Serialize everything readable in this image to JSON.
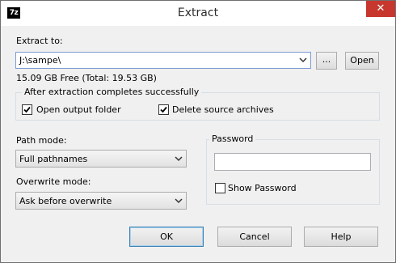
{
  "window": {
    "title": "Extract",
    "app_icon": "7z",
    "close_glyph": "✕"
  },
  "extract_to": {
    "label": "Extract to:",
    "path": "J:\\sampe\\",
    "browse_label": "...",
    "open_label": "Open",
    "free_space": "15.09 GB Free (Total: 19.53 GB)"
  },
  "after_extraction": {
    "title": "After extraction completes successfully",
    "open_output_label": "Open output folder",
    "open_output_checked": true,
    "delete_source_label": "Delete source archives",
    "delete_source_checked": true
  },
  "path_mode": {
    "label": "Path mode:",
    "value": "Full pathnames"
  },
  "overwrite_mode": {
    "label": "Overwrite mode:",
    "value": "Ask before overwrite"
  },
  "password": {
    "title": "Password",
    "value": "",
    "show_label": "Show Password",
    "show_checked": false
  },
  "buttons": {
    "ok": "OK",
    "cancel": "Cancel",
    "help": "Help"
  },
  "colors": {
    "close": "#c7372d",
    "focus_border": "#7a9cd3",
    "default_button": "#3c7fb1"
  },
  "icons": {
    "app": "7zip-logo-icon",
    "close": "close-icon",
    "dropdown": "chevron-down-icon",
    "check": "checkmark-icon"
  }
}
